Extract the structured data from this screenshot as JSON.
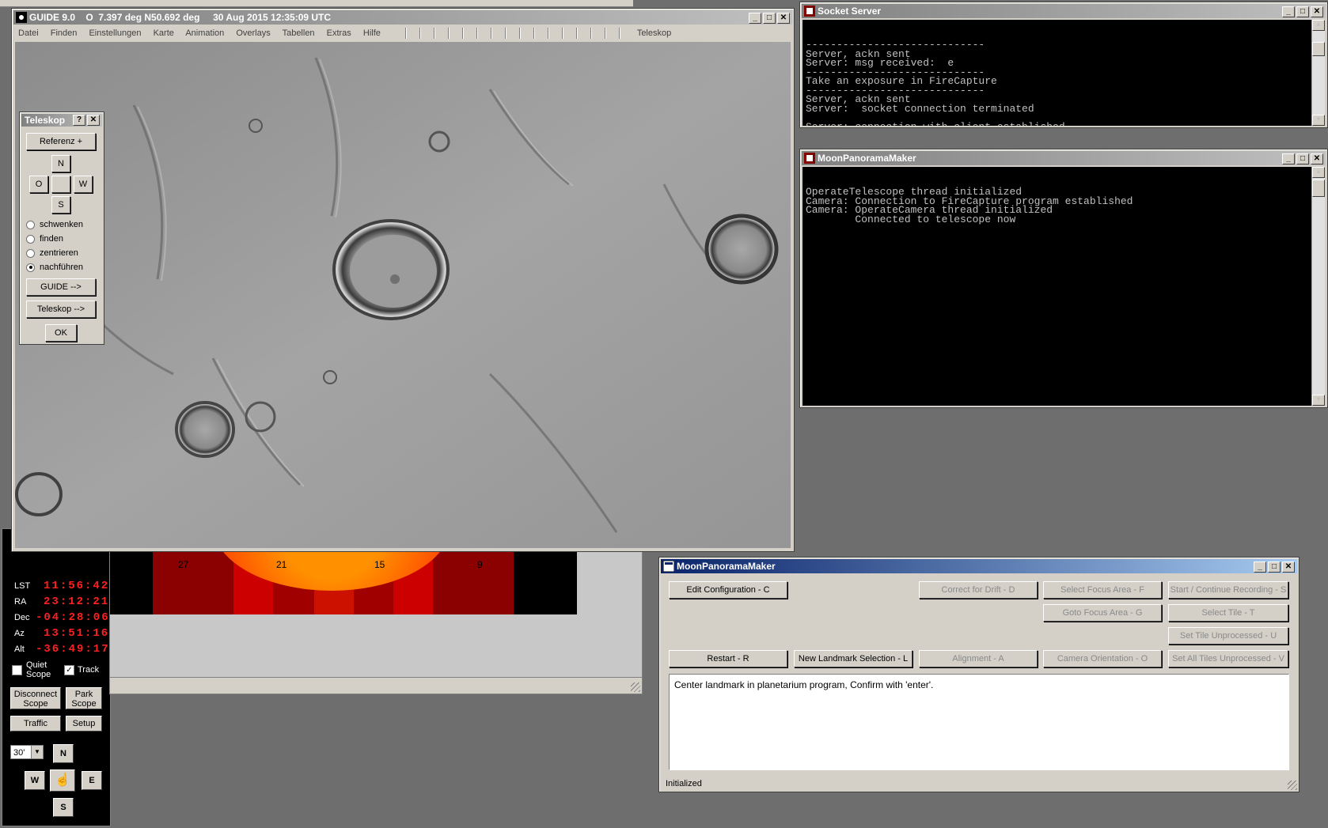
{
  "guide": {
    "title": "GUIDE 9.0    O  7.397 deg N50.692 deg     30 Aug 2015 12:35:09 UTC",
    "menu": [
      "Datei",
      "Finden",
      "Einstellungen",
      "Karte",
      "Animation",
      "Overlays",
      "Tabellen",
      "Extras",
      "Hilfe"
    ],
    "telescope_menu": "Teleskop"
  },
  "teleskop_panel": {
    "title": "Teleskop",
    "help": "?",
    "close": "✕",
    "referenz_button": "Referenz +",
    "dir_n": "N",
    "dir_o": "O",
    "dir_w": "W",
    "dir_s": "S",
    "modes": [
      "schwenken",
      "finden",
      "zentrieren",
      "nachführen"
    ],
    "selected_mode": "nachführen",
    "guide_button": "GUIDE -->",
    "teleskop_button": "Teleskop -->",
    "ok_button": "OK"
  },
  "socket_server": {
    "title": "Socket Server",
    "lines": [
      "-----------------------------",
      "Server, ackn sent",
      "Server: msg received:  e",
      "-----------------------------",
      "Take an exposure in FireCapture",
      "-----------------------------",
      "Server, ackn sent",
      "Server:  socket connection terminated",
      "",
      "Server: connection with client established"
    ]
  },
  "mpm_console": {
    "title": "MoonPanoramaMaker",
    "lines": [
      "OperateTelescope thread initialized",
      "Camera: Connection to FireCapture program established",
      "Camera: OperateCamera thread initialized",
      "        Connected to telescope now"
    ]
  },
  "mpm_main": {
    "title": "MoonPanoramaMaker",
    "buttons": {
      "edit_config": "Edit Configuration - C",
      "correct_drift": "Correct for Drift - D",
      "select_focus": "Select Focus Area - F",
      "start_recording": "Start / Continue Recording - S",
      "goto_focus": "Goto Focus Area - G",
      "select_tile": "Select Tile - T",
      "set_tile_unproc": "Set Tile Unprocessed - U",
      "restart": "Restart - R",
      "new_landmark": "New Landmark Selection - L",
      "alignment": "Alignment - A",
      "camera_orientation": "Camera Orientation - O",
      "set_all_unproc": "Set All Tiles Unprocessed - V"
    },
    "message": "Center landmark in planetarium program, Confirm with 'enter'.",
    "status": "Initialized"
  },
  "scope_panel": {
    "labels": [
      "LST",
      "RA",
      "Dec",
      "Az",
      "Alt"
    ],
    "values": [
      "11:56:42",
      "23:12:21",
      "-04:28:06",
      "13:51:16",
      "-36:49:17"
    ],
    "quiet_scope": "Quiet\nScope",
    "track": "Track",
    "disconnect": "Disconnect\nScope",
    "park": "Park\nScope",
    "traffic": "Traffic",
    "setup": "Setup",
    "zoom": "30'",
    "n": "N",
    "w": "W",
    "e": "E",
    "s": "S"
  },
  "heatmap": {
    "labels": [
      "27",
      "21",
      "15",
      "9"
    ]
  },
  "colors": {
    "active_title": "#0a246a",
    "inactive_title": "#808080",
    "lcd": "#ff2020"
  }
}
